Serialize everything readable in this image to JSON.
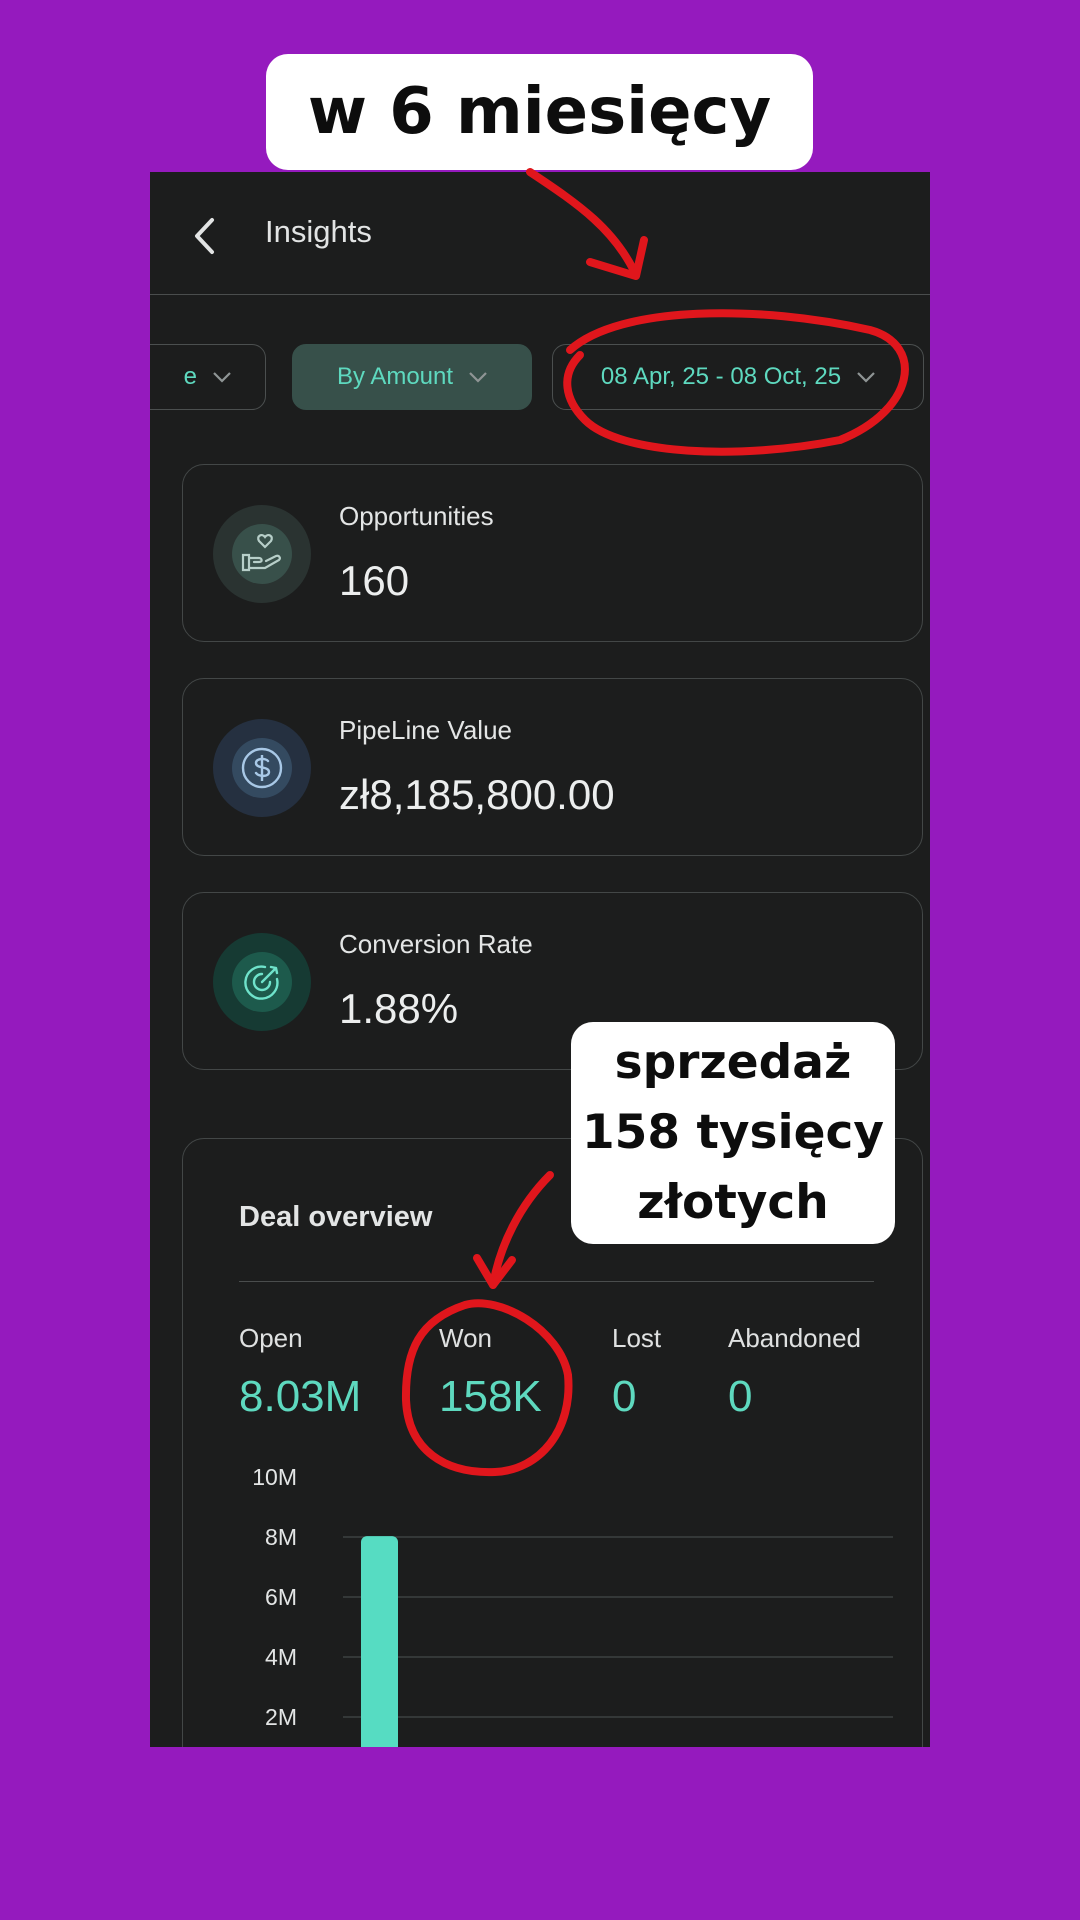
{
  "annotations": {
    "top_caption": "w 6 miesięcy",
    "side_caption": "sprzedaż\n158 tysięcy\nzłotych",
    "ink_color": "#e0161c"
  },
  "app_bar": {
    "title": "Insights",
    "back_icon": "chevron-left-icon"
  },
  "filters": [
    {
      "label": "e",
      "state": "partially-hidden"
    },
    {
      "label": "By Amount",
      "state": "selected"
    },
    {
      "label": "08 Apr, 25 - 08 Oct, 25"
    }
  ],
  "stats": [
    {
      "label": "Opportunities",
      "value": "160",
      "icon": "hand-heart-icon",
      "color": "#9cb8b2"
    },
    {
      "label": "PipeLine Value",
      "value": "zł8,185,800.00",
      "icon": "dollar-circle-icon",
      "color": "#8fb8dc"
    },
    {
      "label": "Conversion Rate",
      "value": "1.88%",
      "icon": "target-arrow-icon",
      "color": "#5ed9bf"
    }
  ],
  "deal_overview": {
    "title": "Deal overview",
    "metrics": [
      {
        "label": "Open",
        "value": "8.03M"
      },
      {
        "label": "Won",
        "value": "158K"
      },
      {
        "label": "Lost",
        "value": "0"
      },
      {
        "label": "Abandoned",
        "value": "0"
      }
    ]
  },
  "chart_data": {
    "type": "bar",
    "y_ticks": [
      "10M",
      "8M",
      "6M",
      "4M",
      "2M"
    ],
    "ylim": [
      0,
      10000000
    ],
    "values": [
      8030000
    ],
    "bar_color": "#56dcc2",
    "grid": true
  },
  "colors": {
    "background": "#951abe",
    "panel": "#1c1d1d",
    "accent": "#5ed9bf"
  }
}
